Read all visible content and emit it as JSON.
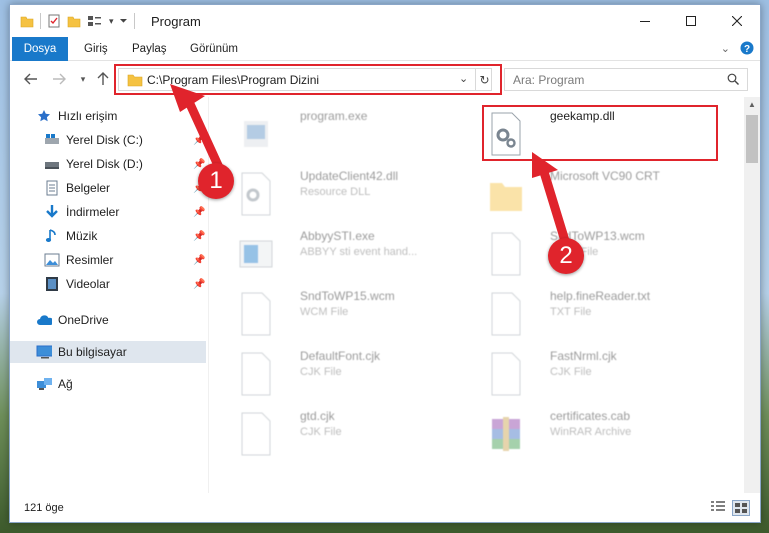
{
  "window": {
    "title": "Program"
  },
  "ribbon": {
    "tabs": [
      "Dosya",
      "Giriş",
      "Paylaş",
      "Görünüm"
    ]
  },
  "address": {
    "path": "C:\\Program Files\\Program Dizini"
  },
  "search": {
    "placeholder": "Ara: Program"
  },
  "sidebar": {
    "items": [
      {
        "label": "Hızlı erişim",
        "icon": "star-icon"
      },
      {
        "label": "Yerel Disk (C:)",
        "icon": "drive-icon",
        "pinned": true
      },
      {
        "label": "Yerel Disk (D:)",
        "icon": "drive-icon",
        "pinned": true
      },
      {
        "label": "Belgeler",
        "icon": "documents-icon",
        "pinned": true
      },
      {
        "label": "İndirmeler",
        "icon": "download-icon",
        "pinned": true
      },
      {
        "label": "Müzik",
        "icon": "music-icon",
        "pinned": true
      },
      {
        "label": "Resimler",
        "icon": "pictures-icon",
        "pinned": true
      },
      {
        "label": "Videolar",
        "icon": "video-icon",
        "pinned": true
      },
      {
        "label": "OneDrive",
        "icon": "cloud-icon"
      },
      {
        "label": "Bu bilgisayar",
        "icon": "computer-icon",
        "selected": true
      },
      {
        "label": "Ağ",
        "icon": "network-icon"
      }
    ]
  },
  "files": [
    {
      "name": "program.exe",
      "type": "",
      "icon": "exe-icon"
    },
    {
      "name": "geekamp.dll",
      "type": "",
      "icon": "dll-gear-icon"
    },
    {
      "name": "UpdateClient42.dll",
      "type": "Resource DLL",
      "icon": "dll-gear-icon"
    },
    {
      "name": "Microsoft VC90 CRT",
      "type": "",
      "icon": "folder-icon"
    },
    {
      "name": "AbbyySTI.exe",
      "type": "ABBYY sti event hand...",
      "icon": "exe-window-icon"
    },
    {
      "name": "SndToWP13.wcm",
      "type": "WCM File",
      "icon": "document-icon"
    },
    {
      "name": "SndToWP15.wcm",
      "type": "WCM File",
      "icon": "document-icon"
    },
    {
      "name": "help.fineReader.txt",
      "type": "TXT File",
      "icon": "document-icon"
    },
    {
      "name": "DefaultFont.cjk",
      "type": "CJK File",
      "icon": "document-icon"
    },
    {
      "name": "FastNrml.cjk",
      "type": "CJK File",
      "icon": "document-icon"
    },
    {
      "name": "gtd.cjk",
      "type": "CJK File",
      "icon": "document-icon"
    },
    {
      "name": "certificates.cab",
      "type": "WinRAR Archive",
      "icon": "winrar-icon"
    }
  ],
  "status": {
    "count": "121 öge"
  },
  "annotations": {
    "step1": "1",
    "step2": "2",
    "color": "#e0242c"
  },
  "colors": {
    "accent": "#1979ca",
    "highlight": "#e0242c"
  }
}
